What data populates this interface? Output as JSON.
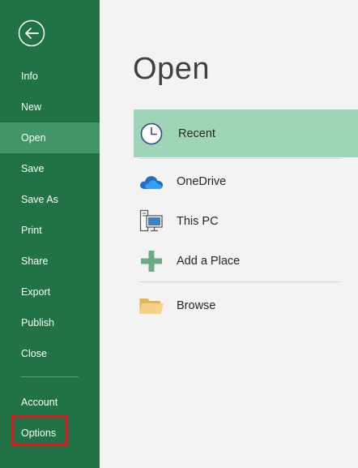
{
  "backstage": {
    "nav": [
      {
        "label": "Info",
        "active": false
      },
      {
        "label": "New",
        "active": false
      },
      {
        "label": "Open",
        "active": true
      },
      {
        "label": "Save",
        "active": false
      },
      {
        "label": "Save As",
        "active": false
      },
      {
        "label": "Print",
        "active": false
      },
      {
        "label": "Share",
        "active": false
      },
      {
        "label": "Export",
        "active": false
      },
      {
        "label": "Publish",
        "active": false
      },
      {
        "label": "Close",
        "active": false
      }
    ],
    "bottom_nav": [
      {
        "label": "Account"
      },
      {
        "label": "Options"
      }
    ]
  },
  "main": {
    "title": "Open",
    "locations": [
      {
        "label": "Recent",
        "icon": "clock-icon",
        "selected": true
      },
      {
        "label": "OneDrive",
        "icon": "cloud-icon",
        "selected": false
      },
      {
        "label": "This PC",
        "icon": "computer-icon",
        "selected": false
      },
      {
        "label": "Add a Place",
        "icon": "plus-icon",
        "selected": false
      },
      {
        "label": "Browse",
        "icon": "folder-icon",
        "selected": false
      }
    ]
  },
  "colors": {
    "sidebar": "#217346",
    "sidebar_active": "#439467",
    "selected_location": "#9fd5b7",
    "highlight_box": "#e8141e"
  }
}
